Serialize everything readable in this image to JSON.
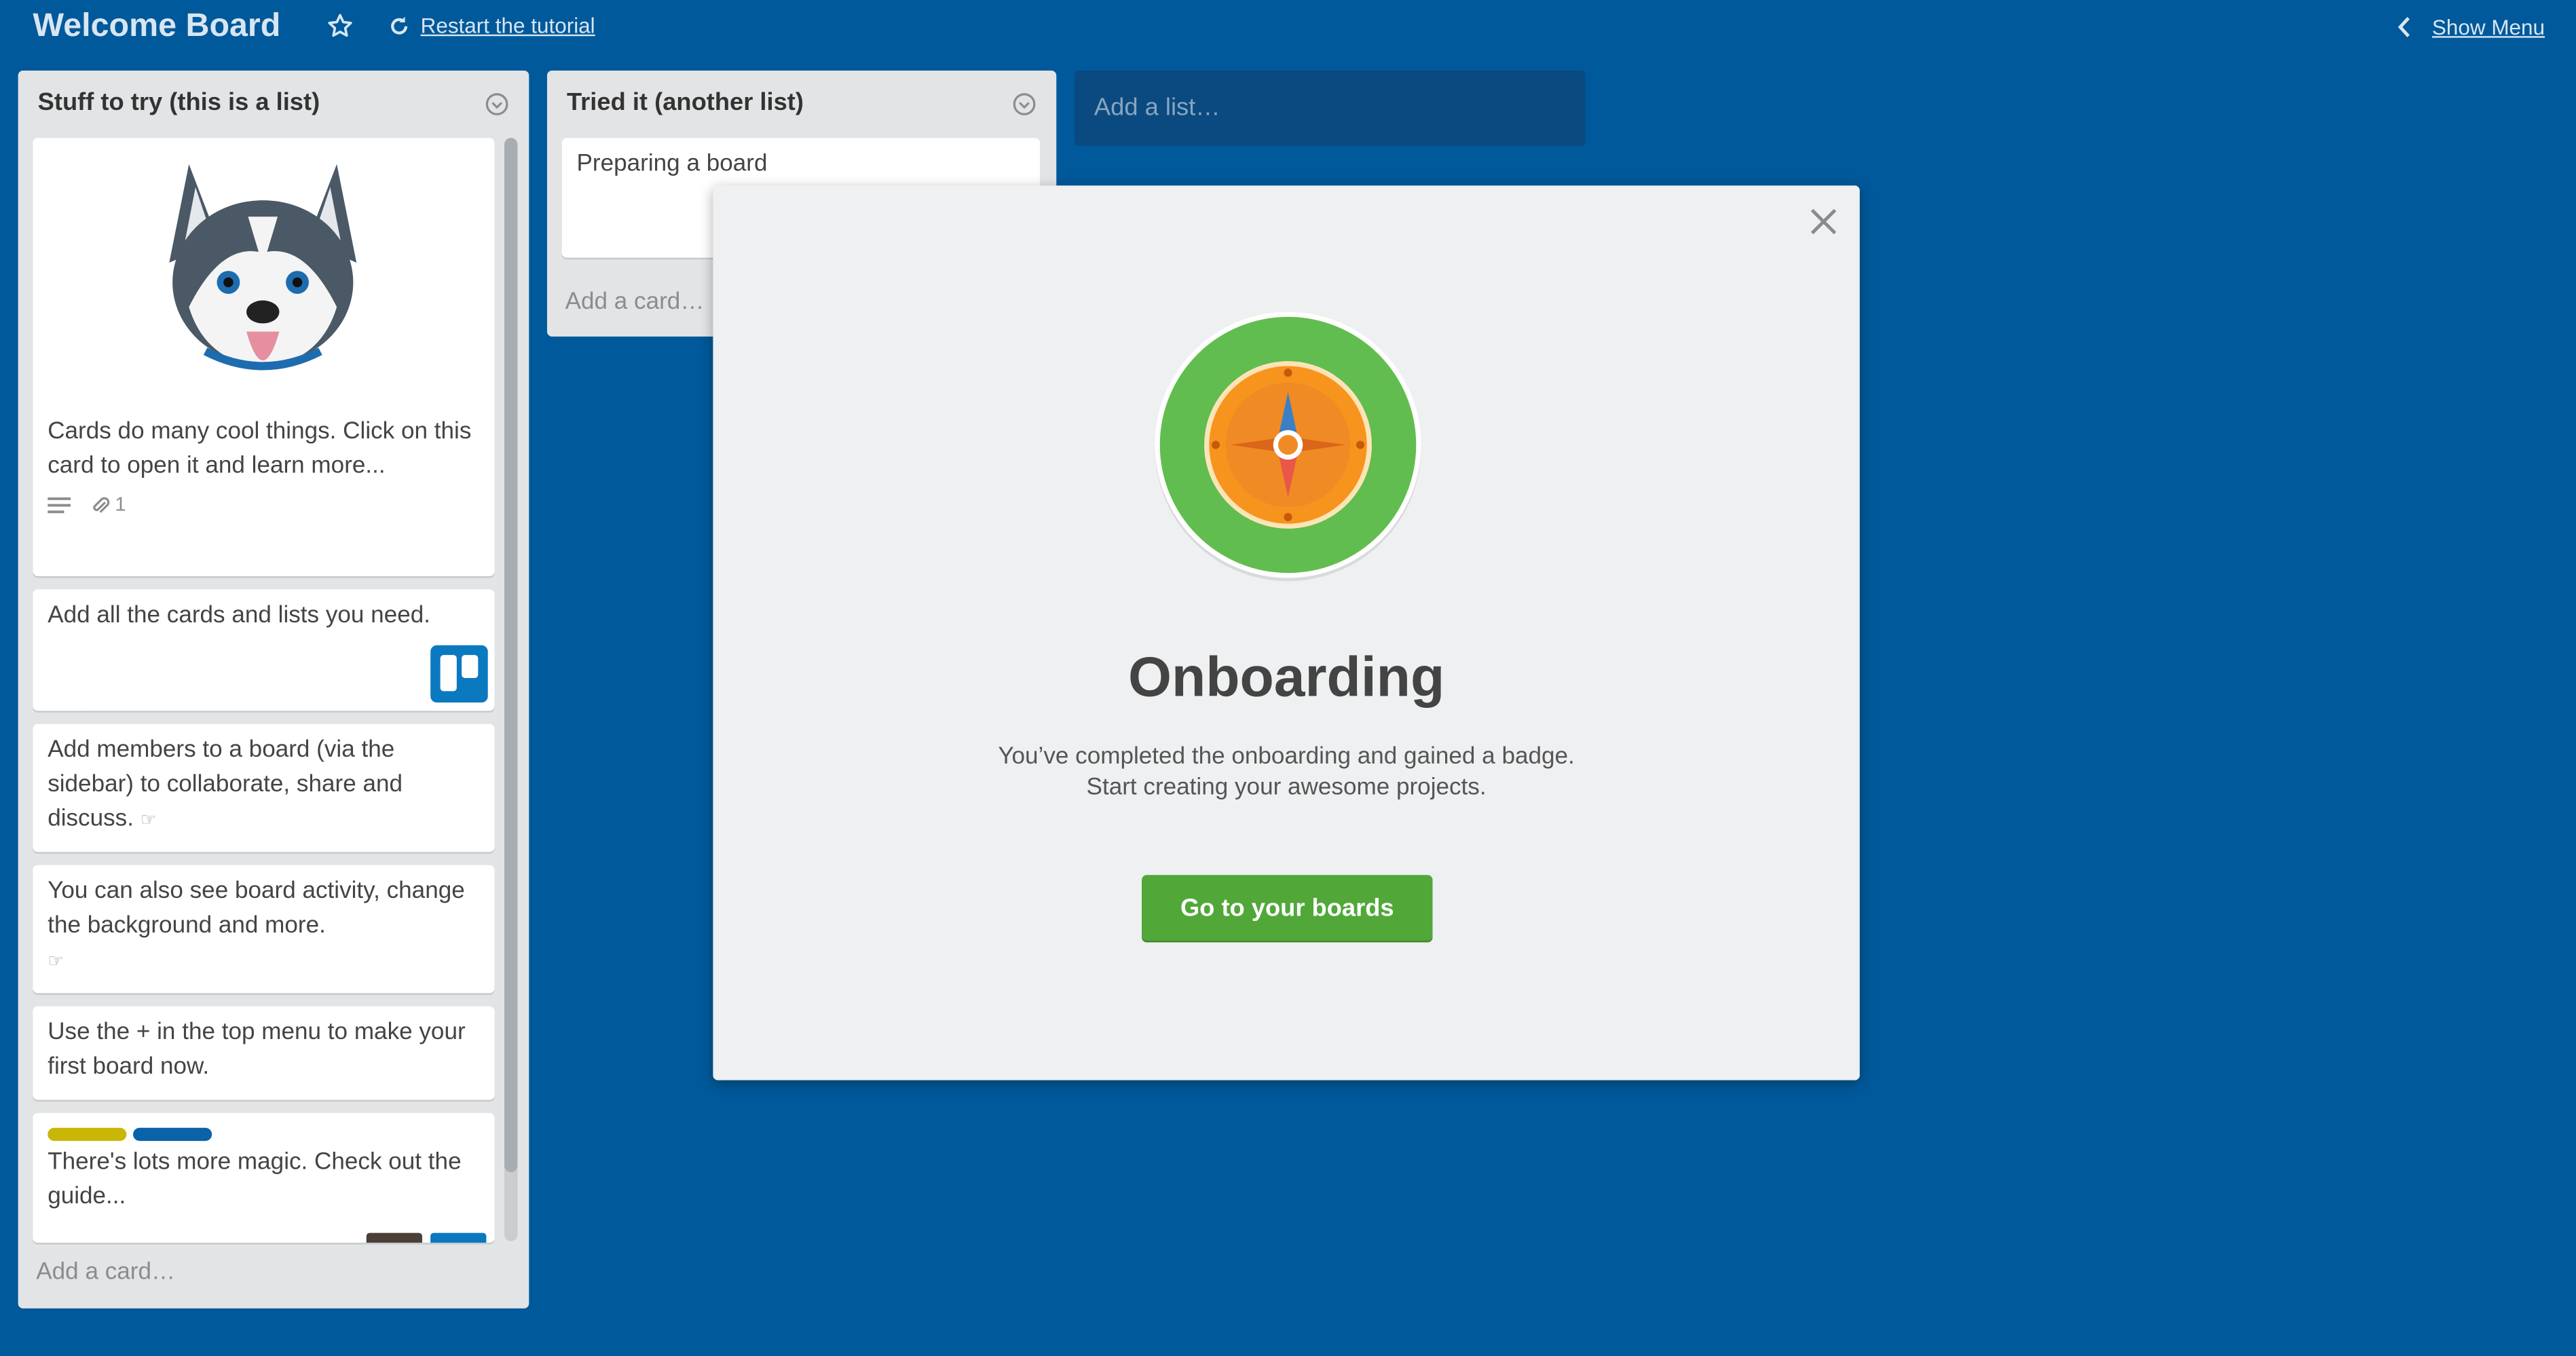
{
  "header": {
    "board_title": "Welcome Board",
    "restart_label": "Restart the tutorial",
    "show_menu_label": "Show Menu"
  },
  "lists": [
    {
      "title": "Stuff to try (this is a list)",
      "cards": [
        {
          "text": "Cards do many cool things. Click on this card to open it and learn more...",
          "attachments": "1",
          "has_description": true,
          "cover": "husky-mascot"
        },
        {
          "text": "Add all the cards and lists you need.",
          "icon": "trello-logo-icon"
        },
        {
          "text": "Add members to a board (via the sidebar) to collaborate, share and discuss.",
          "icon": "pointing-hand-icon"
        },
        {
          "text": "You can also see board activity, change the background and more.",
          "icon": "pointing-hand-icon"
        },
        {
          "text": "Use the + in the top menu to make your first board now."
        },
        {
          "text": "There's lots more magic. Check out the guide...",
          "labels": [
            "#c9b707",
            "#0a62a8"
          ]
        }
      ],
      "add_card": "Add a card…"
    },
    {
      "title": "Tried it (another list)",
      "cards": [
        {
          "text": "Preparing a board"
        }
      ],
      "add_card": "Add a card…"
    }
  ],
  "add_list_placeholder": "Add a list…",
  "modal": {
    "title": "Onboarding",
    "message_line1": "You’ve completed the onboarding and gained a badge.",
    "message_line2": "Start creating your awesome projects.",
    "button_label": "Go to your boards",
    "badge_icon": "compass-icon"
  },
  "colors": {
    "board_background": "#00599a",
    "list_background": "#e2e4e6",
    "button_green": "#51a839",
    "badge_outer": "#61bd4f",
    "badge_inner": "#f7941d"
  }
}
